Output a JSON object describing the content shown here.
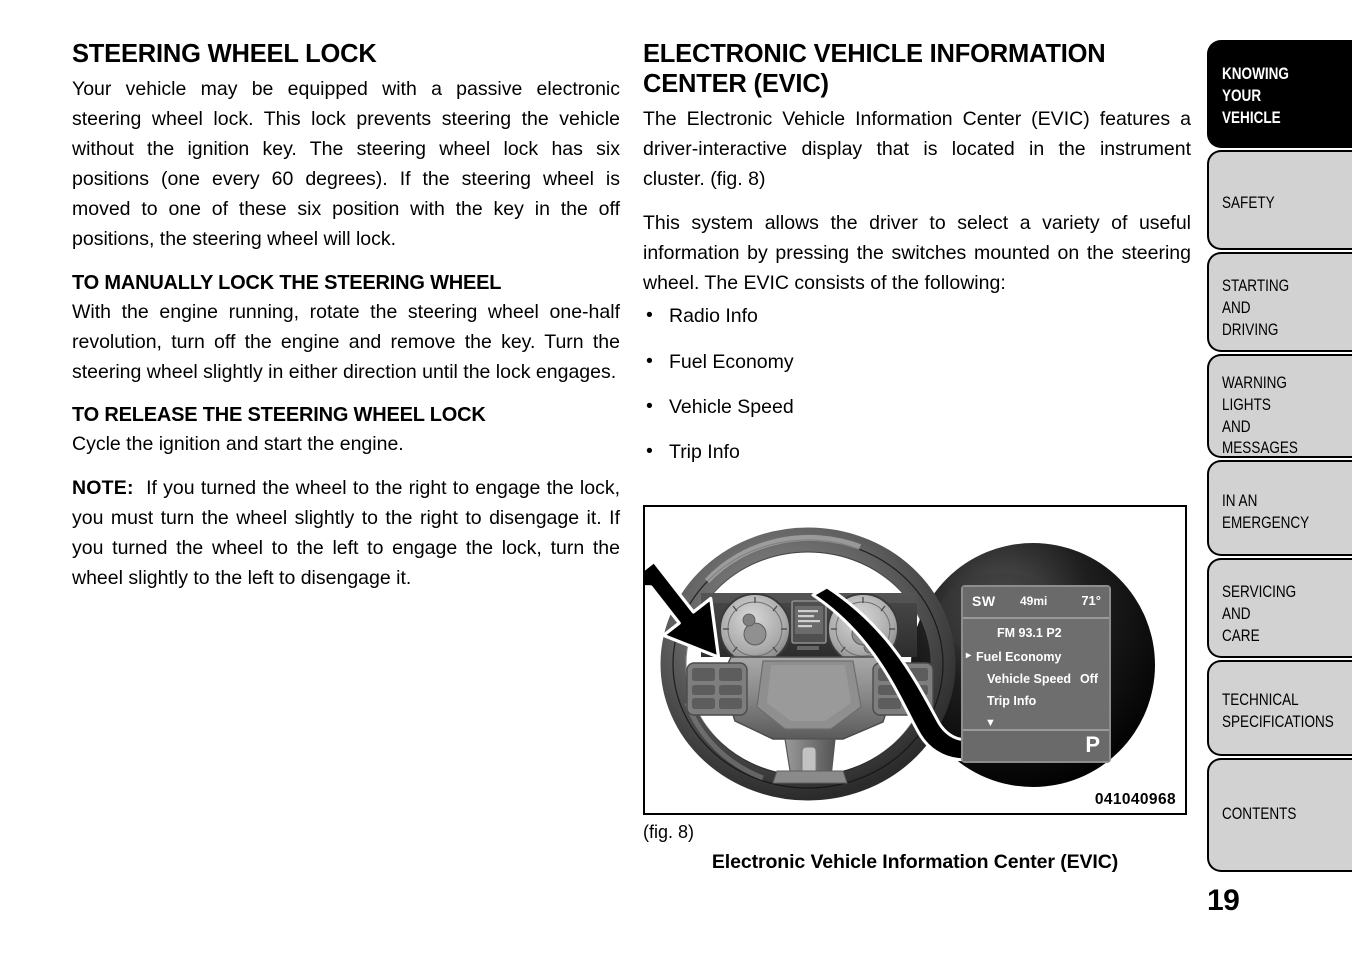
{
  "document": {
    "page_number": "19"
  },
  "left_column": {
    "title": "STEERING WHEEL LOCK",
    "intro": "Your vehicle may be equipped with a passive electronic steering wheel lock. This lock prevents steering the vehicle without the ignition key. The steering wheel lock has six positions (one every 60 degrees). If the steering wheel is moved to one of these six position with the key in the off positions, the steering wheel will lock.",
    "sub1_title": "TO MANUALLY LOCK THE STEERING WHEEL",
    "sub1_body": "With the engine running, rotate the steering wheel one-half revolution, turn off the engine and remove the key. Turn the steering wheel slightly in either direction until the lock engages.",
    "sub2_title": "TO RELEASE THE STEERING WHEEL LOCK",
    "sub2_body": "Cycle the ignition and start the engine.",
    "note_label": "NOTE:",
    "note_body": "If you turned the wheel to the right to engage the lock, you must turn the wheel slightly to the right to disengage it. If you turned the wheel to the left to engage the lock, turn the wheel slightly to the left to disengage it."
  },
  "right_column": {
    "title": "ELECTRONIC VEHICLE INFORMATION CENTER (EVIC)",
    "para1": "The Electronic Vehicle Information Center (EVIC) features a driver-interactive display that is located in the instrument cluster.  (fig. 8)",
    "para2": "This system allows the driver to select a variety of useful information by pressing the switches mounted on the steering wheel. The EVIC consists of the following:",
    "bullet_char": "•",
    "bullets": [
      "Radio Info",
      "Fuel Economy",
      "Vehicle Speed",
      "Trip Info"
    ]
  },
  "figure": {
    "id_number": "041040968",
    "number_label": "(fig. 8)",
    "caption": "Electronic Vehicle Information Center (EVIC)",
    "evic_display": {
      "compass": "SW",
      "distance": "49mi",
      "temperature": "71°",
      "radio_preset": "FM 93.1 P2",
      "selected_caret": "▸",
      "menu_items": [
        "Fuel Economy",
        "Vehicle Speed",
        "Trip Info"
      ],
      "vehicle_speed_value": "Off",
      "scroll_down_caret": "▼",
      "gear_indicator": "P"
    }
  },
  "sidebar": {
    "tabs": [
      {
        "label": "KNOWING\nYOUR\nVEHICLE",
        "active": true
      },
      {
        "label": "SAFETY",
        "active": false
      },
      {
        "label": "STARTING\nAND\nDRIVING",
        "active": false
      },
      {
        "label": "WARNING\nLIGHTS\nAND\nMESSAGES",
        "active": false
      },
      {
        "label": "IN AN\nEMERGENCY",
        "active": false
      },
      {
        "label": "SERVICING\nAND\nCARE",
        "active": false
      },
      {
        "label": "TECHNICAL\nSPECIFICATIONS",
        "active": false
      },
      {
        "label": "CONTENTS",
        "active": false
      }
    ]
  },
  "colors": {
    "tab_active_bg": "#000000",
    "tab_inactive_bg": "#d2d2d2",
    "screen_bg": "#6e6e6e",
    "text": "#000000"
  }
}
